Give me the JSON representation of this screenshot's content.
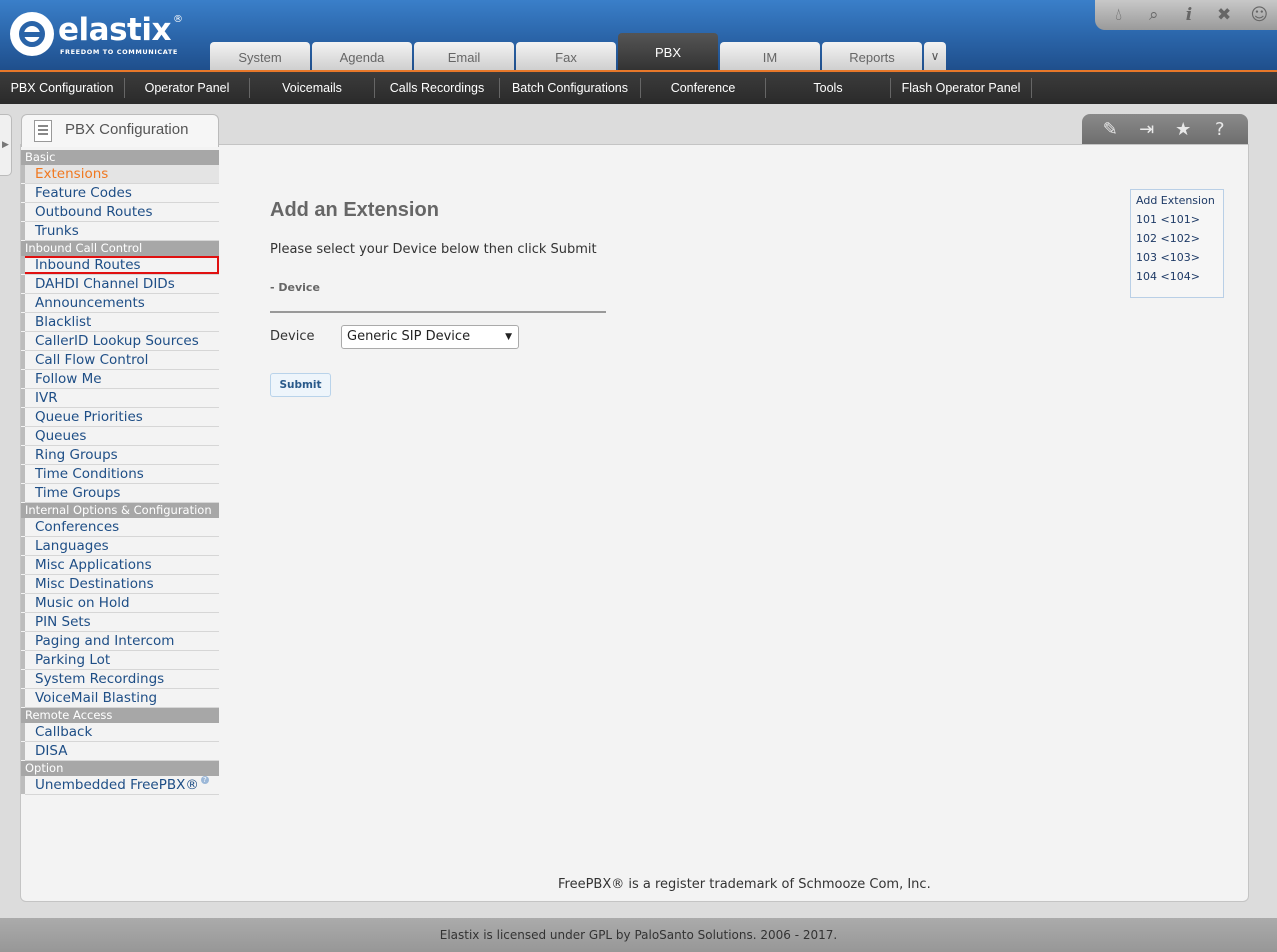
{
  "brand": {
    "name": "elastix",
    "registered": "®",
    "tagline": "FREEDOM TO COMMUNICATE"
  },
  "top_icons": [
    "theme-icon",
    "search-icon",
    "info-icon",
    "tools-icon",
    "user-icon"
  ],
  "main_tabs": [
    "System",
    "Agenda",
    "Email",
    "Fax",
    "PBX",
    "IM",
    "Reports"
  ],
  "main_tabs_active": "PBX",
  "subnav": [
    "PBX Configuration",
    "Operator Panel",
    "Voicemails",
    "Calls Recordings",
    "Batch Configurations",
    "Conference",
    "Tools",
    "Flash Operator Panel"
  ],
  "page_tab": {
    "title": "PBX Configuration"
  },
  "right_tools": [
    "edit-icon",
    "logout-icon",
    "star-icon",
    "help-icon"
  ],
  "sidebar": {
    "basic": {
      "label": "Basic",
      "items": [
        "Extensions",
        "Feature Codes",
        "Outbound Routes",
        "Trunks"
      ]
    },
    "inbound": {
      "label": "Inbound Call Control",
      "items": [
        "Inbound Routes",
        "DAHDI Channel DIDs",
        "Announcements",
        "Blacklist",
        "CallerID Lookup Sources",
        "Call Flow Control",
        "Follow Me",
        "IVR",
        "Queue Priorities",
        "Queues",
        "Ring Groups",
        "Time Conditions",
        "Time Groups"
      ]
    },
    "internal": {
      "label": "Internal Options & Configuration",
      "items": [
        "Conferences",
        "Languages",
        "Misc Applications",
        "Misc Destinations",
        "Music on Hold",
        "PIN Sets",
        "Paging and Intercom",
        "Parking Lot",
        "System Recordings",
        "VoiceMail Blasting"
      ]
    },
    "remote": {
      "label": "Remote Access",
      "items": [
        "Callback",
        "DISA"
      ]
    },
    "option": {
      "label": "Option",
      "items": [
        "Unembedded FreePBX®"
      ]
    }
  },
  "main": {
    "heading": "Add an Extension",
    "instructions": "Please select your Device below then click Submit",
    "section": "- Device",
    "device_label": "Device",
    "device_value": "Generic SIP Device",
    "submit": "Submit"
  },
  "extensions_box": {
    "add": "Add Extension",
    "items": [
      "101 <101>",
      "102 <102>",
      "103 <103>",
      "104 <104>"
    ]
  },
  "trademark": "FreePBX® is a register trademark of Schmooze Com, Inc.",
  "footer": "Elastix is licensed under GPL by PaloSanto Solutions. 2006 - 2017."
}
